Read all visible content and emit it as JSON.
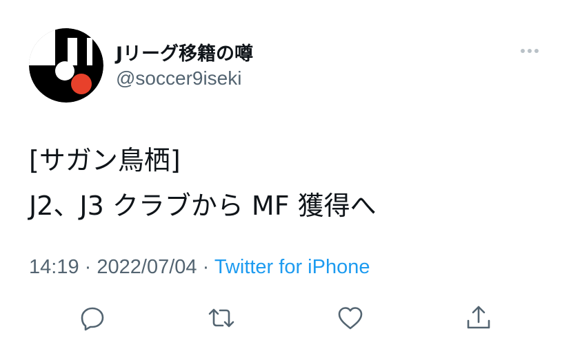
{
  "user": {
    "display_name": "Jリーグ移籍の噂",
    "handle": "@soccer9iseki"
  },
  "tweet": {
    "line1": "[サガン鳥栖]",
    "line2": "J2、J3 クラブから MF 獲得へ"
  },
  "meta": {
    "time": "14:19",
    "date": "2022/07/04",
    "separator": "·",
    "source": "Twitter for iPhone"
  },
  "icons": {
    "avatar": "avatar-logo",
    "more": "more-icon",
    "reply": "reply-icon",
    "retweet": "retweet-icon",
    "like": "like-icon",
    "share": "share-icon"
  },
  "colors": {
    "text": "#0f1419",
    "secondary": "#536471",
    "link": "#1d9bf0",
    "avatar_accent": "#e8412b"
  }
}
